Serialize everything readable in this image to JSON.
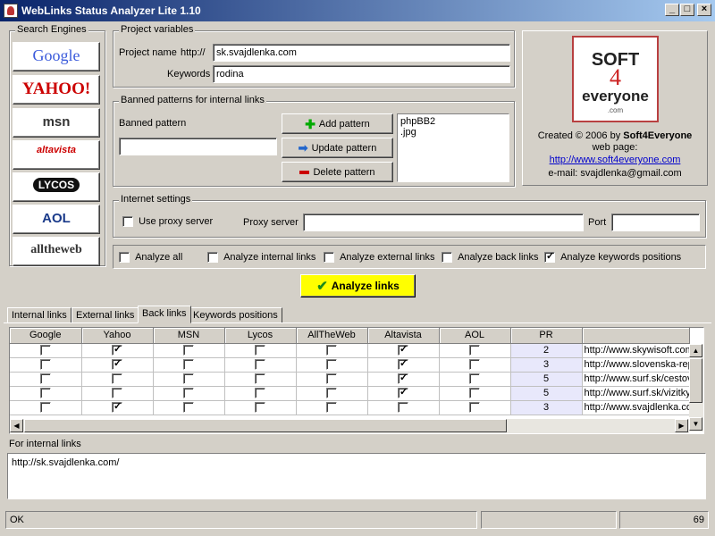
{
  "window": {
    "title": "WebLinks Status Analyzer Lite 1.10",
    "min_icon": "minimize-icon",
    "max_icon": "maximize-icon",
    "close_icon": "close-icon"
  },
  "search_engines": {
    "label": "Search Engines",
    "items": [
      "Google",
      "YAHOO!",
      "msn",
      "altavista",
      "LYCOS",
      "AOL",
      "alltheweb"
    ]
  },
  "project": {
    "label": "Project variables",
    "name_label": "Project name",
    "http_prefix": "http://",
    "name_value": "sk.svajdlenka.com",
    "keywords_label": "Keywords",
    "keywords_value": "rodina"
  },
  "banned": {
    "label": "Banned patterns for internal links",
    "pattern_label": "Banned pattern",
    "pattern_value": "",
    "add": "Add pattern",
    "update": "Update pattern",
    "delete": "Delete pattern",
    "list": [
      "phpBB2",
      ".jpg"
    ]
  },
  "about": {
    "logo_line1": "SOFT",
    "logo_digit": "4",
    "logo_line2": "everyone",
    "logo_line3": ".com",
    "created_prefix": "Created © 2006 by ",
    "created_by": "Soft4Everyone",
    "webpage_label": "web page:",
    "webpage_url": "http://www.soft4everyone.com",
    "email": "e-mail: svajdlenka@gmail.com"
  },
  "internet": {
    "label": "Internet settings",
    "use_proxy": "Use proxy server",
    "use_proxy_checked": false,
    "proxy_label": "Proxy server",
    "proxy_value": "",
    "port_label": "Port",
    "port_value": ""
  },
  "analyze_options": [
    {
      "label": "Analyze all",
      "checked": false
    },
    {
      "label": "Analyze internal links",
      "checked": false
    },
    {
      "label": "Analyze external links",
      "checked": false
    },
    {
      "label": "Analyze back links",
      "checked": false
    },
    {
      "label": "Analyze keywords positions",
      "checked": true
    }
  ],
  "analyze_button": "Analyze links",
  "tabs": [
    "Internal links",
    "External links",
    "Back links",
    "Keywords positions"
  ],
  "active_tab": "Back links",
  "table": {
    "columns": [
      "Google",
      "Yahoo",
      "MSN",
      "Lycos",
      "AllTheWeb",
      "Altavista",
      "AOL",
      "PR",
      ""
    ],
    "rows": [
      {
        "checks": [
          false,
          true,
          false,
          false,
          false,
          true,
          false
        ],
        "pr": "2",
        "url": "http://www.skywisoft.com/"
      },
      {
        "checks": [
          false,
          true,
          false,
          false,
          false,
          true,
          false
        ],
        "pr": "3",
        "url": "http://www.slovenska-republika.sk/"
      },
      {
        "checks": [
          false,
          false,
          false,
          false,
          false,
          true,
          false
        ],
        "pr": "5",
        "url": "http://www.surf.sk/cestovanie/"
      },
      {
        "checks": [
          false,
          false,
          false,
          false,
          false,
          true,
          false
        ],
        "pr": "5",
        "url": "http://www.surf.sk/vizitky/"
      },
      {
        "checks": [
          false,
          true,
          false,
          false,
          false,
          false,
          false
        ],
        "pr": "3",
        "url": "http://www.svajdlenka.com/"
      }
    ]
  },
  "internal_links": {
    "label": "For internal links",
    "value": "http://sk.svajdlenka.com/"
  },
  "status": {
    "text": "OK",
    "count": "69"
  }
}
